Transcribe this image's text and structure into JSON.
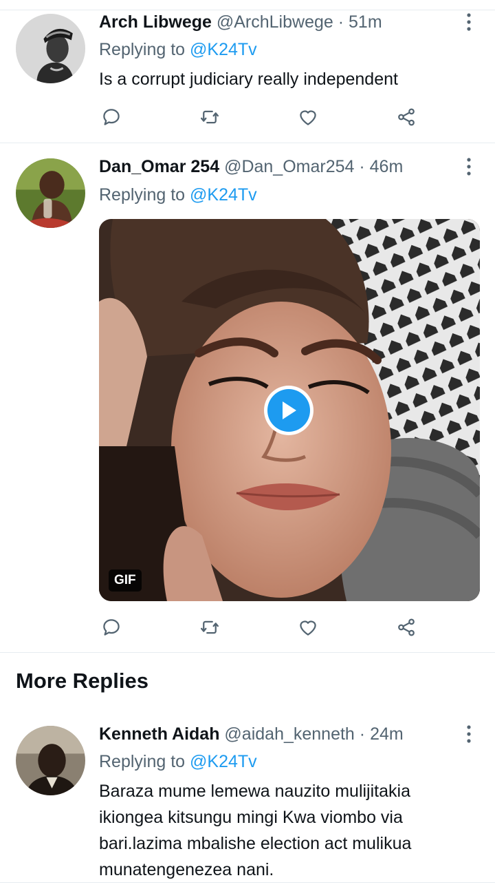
{
  "tweets": [
    {
      "name": "Arch Libwege",
      "handle": "@ArchLibwege",
      "separator": "·",
      "time": "51m",
      "replying_prefix": "Replying to",
      "replying_to": "@K24Tv",
      "text": "Is a corrupt judiciary really independent"
    },
    {
      "name": "Dan_Omar 254",
      "handle": "@Dan_Omar254",
      "separator": "·",
      "time": "46m",
      "replying_prefix": "Replying to",
      "replying_to": "@K24Tv",
      "media_badge": "GIF"
    }
  ],
  "more_replies": {
    "title": "More Replies",
    "tweets": [
      {
        "name": "Kenneth Aidah",
        "handle": "@aidah_kenneth",
        "separator": "·",
        "time": "24m",
        "replying_prefix": "Replying to",
        "replying_to": "@K24Tv",
        "text": "Baraza mume lemewa nauzito mulijitakia ikiongea kitsungu mingi Kwa viombo via bari.lazima mbalishe election act mulikua munatengenezea nani."
      }
    ]
  },
  "actions": [
    "reply-icon",
    "retweet-icon",
    "like-icon",
    "share-icon"
  ],
  "colors": {
    "accent": "#1d9bf0",
    "secondary_text": "#536471",
    "divider": "#e6ecf0"
  }
}
